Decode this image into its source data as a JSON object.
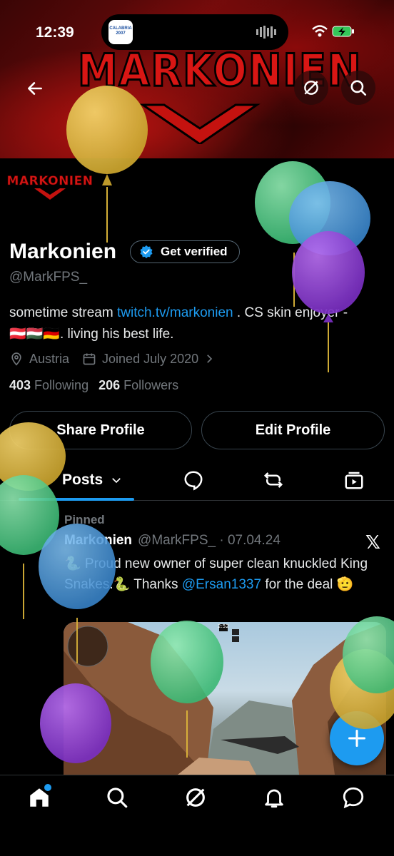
{
  "status_bar": {
    "time": "12:39",
    "island_app_text": "CALABRIA 2007"
  },
  "banner": {
    "logo_text": "MARKONIEN"
  },
  "header": {
    "back_icon": "arrow-left-icon",
    "grok_icon": "grok-icon",
    "search_icon": "search-icon"
  },
  "profile": {
    "avatar_text": "MARKONIEN",
    "name": "Markonien",
    "verify_label": "Get verified",
    "handle": "@MarkFPS_",
    "bio_prefix": "sometime stream ",
    "bio_link": "twitch.tv/markonien",
    "bio_suffix": " . CS skin enjoyer - 🇦🇹🇭🇺🇩🇪. living his best life.",
    "location": "Austria",
    "joined": "Joined July 2020",
    "following_count": "403",
    "following_label": "Following",
    "followers_count": "206",
    "followers_label": "Followers",
    "share_label": "Share Profile",
    "edit_label": "Edit Profile"
  },
  "tabs": {
    "posts_label": "Posts"
  },
  "post": {
    "pinned_label": "Pinned",
    "author_name": "Markonien",
    "author_meta": "@MarkFPS_ · 07.04.24",
    "text_part1": "🐍 Proud new owner of super clean knuckled King Snakes.🐍 Thanks ",
    "mention": "@Ersan1337",
    "text_part2": " for the deal 🫡",
    "hud_time": "2:52"
  },
  "colors": {
    "accent": "#1d9bf0",
    "muted": "#71767b",
    "brand_red": "#d81614"
  }
}
